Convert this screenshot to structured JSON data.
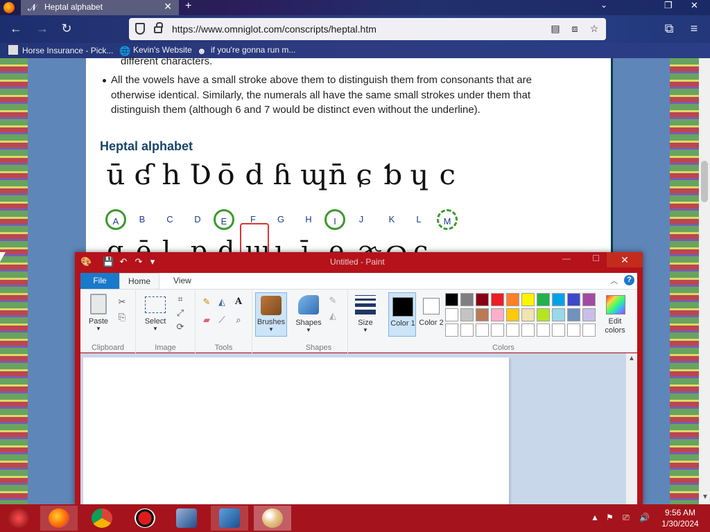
{
  "browser": {
    "tab_title": "Heptal alphabet",
    "tab_close": "✕",
    "new_tab": "+",
    "url": "https://www.omniglot.com/conscripts/heptal.htm",
    "bookmarks": [
      {
        "label": "Horse Insurance - Pick..."
      },
      {
        "label": "Kevin's Website"
      },
      {
        "label": "if you're gonna run m..."
      }
    ]
  },
  "page": {
    "cut_text": "different characters.",
    "bullet": "All the vowels have a small stroke above them to distinguish them from consonants that are otherwise identical. Similarly, the numerals all have the same small strokes under them that distinguish them (although 6 and 7 would be distinct even without the underline).",
    "heading": "Heptal alphabet",
    "letters": [
      "A",
      "B",
      "C",
      "D",
      "E",
      "F",
      "G",
      "H",
      "I",
      "J",
      "K",
      "L",
      "M"
    ],
    "glyphs": [
      "ū",
      "ʛ",
      "h",
      "Ʋ",
      "ō",
      "d",
      "ɦ",
      "ɰ",
      "n̄",
      "ɕ",
      "ƅ",
      "ɥ",
      "c"
    ],
    "glyphs_row2": [
      "ɑ",
      "ē",
      "ɭ",
      "ɒ",
      "ɖ",
      "ɯ",
      "ɩ",
      "ī",
      "ɘ",
      "ɚ",
      "ɷ",
      "ɕ"
    ]
  },
  "paint": {
    "caption": "Untitled - Paint",
    "close": "✕",
    "tabs": {
      "file": "File",
      "home": "Home",
      "view": "View"
    },
    "help": "?",
    "groups": {
      "clipboard": "Clipboard",
      "image": "Image",
      "tools": "Tools",
      "shapes": "Shapes",
      "colors": "Colors"
    },
    "buttons": {
      "paste": "Paste",
      "select": "Select",
      "brushes": "Brushes",
      "shapes": "Shapes",
      "size": "Size",
      "color1": "Color 1",
      "color2": "Color 2",
      "edit_colors": "Edit colors"
    },
    "color1": "#000000",
    "color2": "#ffffff",
    "palette": [
      "#000000",
      "#7f7f7f",
      "#880015",
      "#ed1c24",
      "#ff7f27",
      "#fff200",
      "#22b14c",
      "#00a2e8",
      "#3f48cc",
      "#a349a4",
      "#ffffff",
      "#c3c3c3",
      "#b97a57",
      "#ffaec9",
      "#ffc90e",
      "#efe4b0",
      "#b5e61d",
      "#99d9ea",
      "#7092be",
      "#c8bfe7",
      "#ffffff",
      "#ffffff",
      "#ffffff",
      "#ffffff",
      "#ffffff",
      "#ffffff",
      "#ffffff",
      "#ffffff",
      "#ffffff",
      "#ffffff"
    ]
  },
  "taskbar": {
    "time": "9:56 AM",
    "date": "1/30/2024"
  }
}
